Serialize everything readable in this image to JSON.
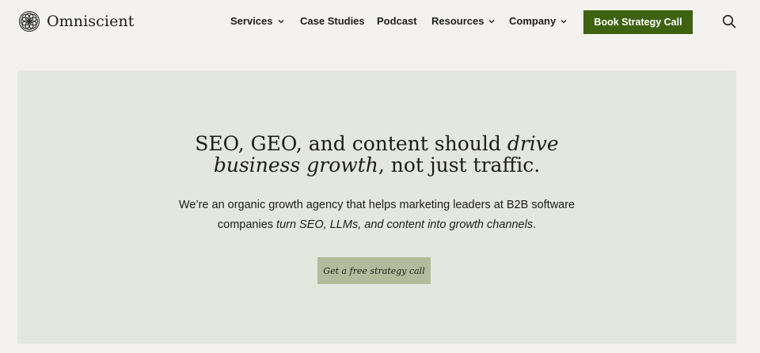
{
  "brand": {
    "name": "Omniscient",
    "logo_icon": "knot-logo-icon"
  },
  "nav": {
    "services": "Services",
    "case_studies": "Case Studies",
    "podcast": "Podcast",
    "resources": "Resources",
    "company": "Company"
  },
  "header_cta": "Book Strategy Call",
  "search_icon": "search-icon",
  "hero": {
    "headline_part1": "SEO, GEO, and content should ",
    "headline_em1": "drive",
    "headline_em2": "business growth",
    "headline_part2": ", not just traffic.",
    "sub_part1": "We’re an organic growth agency that helps marketing leaders at B2B software",
    "sub_part2": "companies ",
    "sub_em": "turn SEO, LLMs, and content into growth channels",
    "sub_part3": ".",
    "cta": "Get a free strategy call"
  },
  "colors": {
    "page_bg": "#f3f2ee",
    "hero_bg": "#e4e7de",
    "primary_button": "#3f6211",
    "secondary_button": "#b3bb9c",
    "text": "#1d1d1b"
  }
}
